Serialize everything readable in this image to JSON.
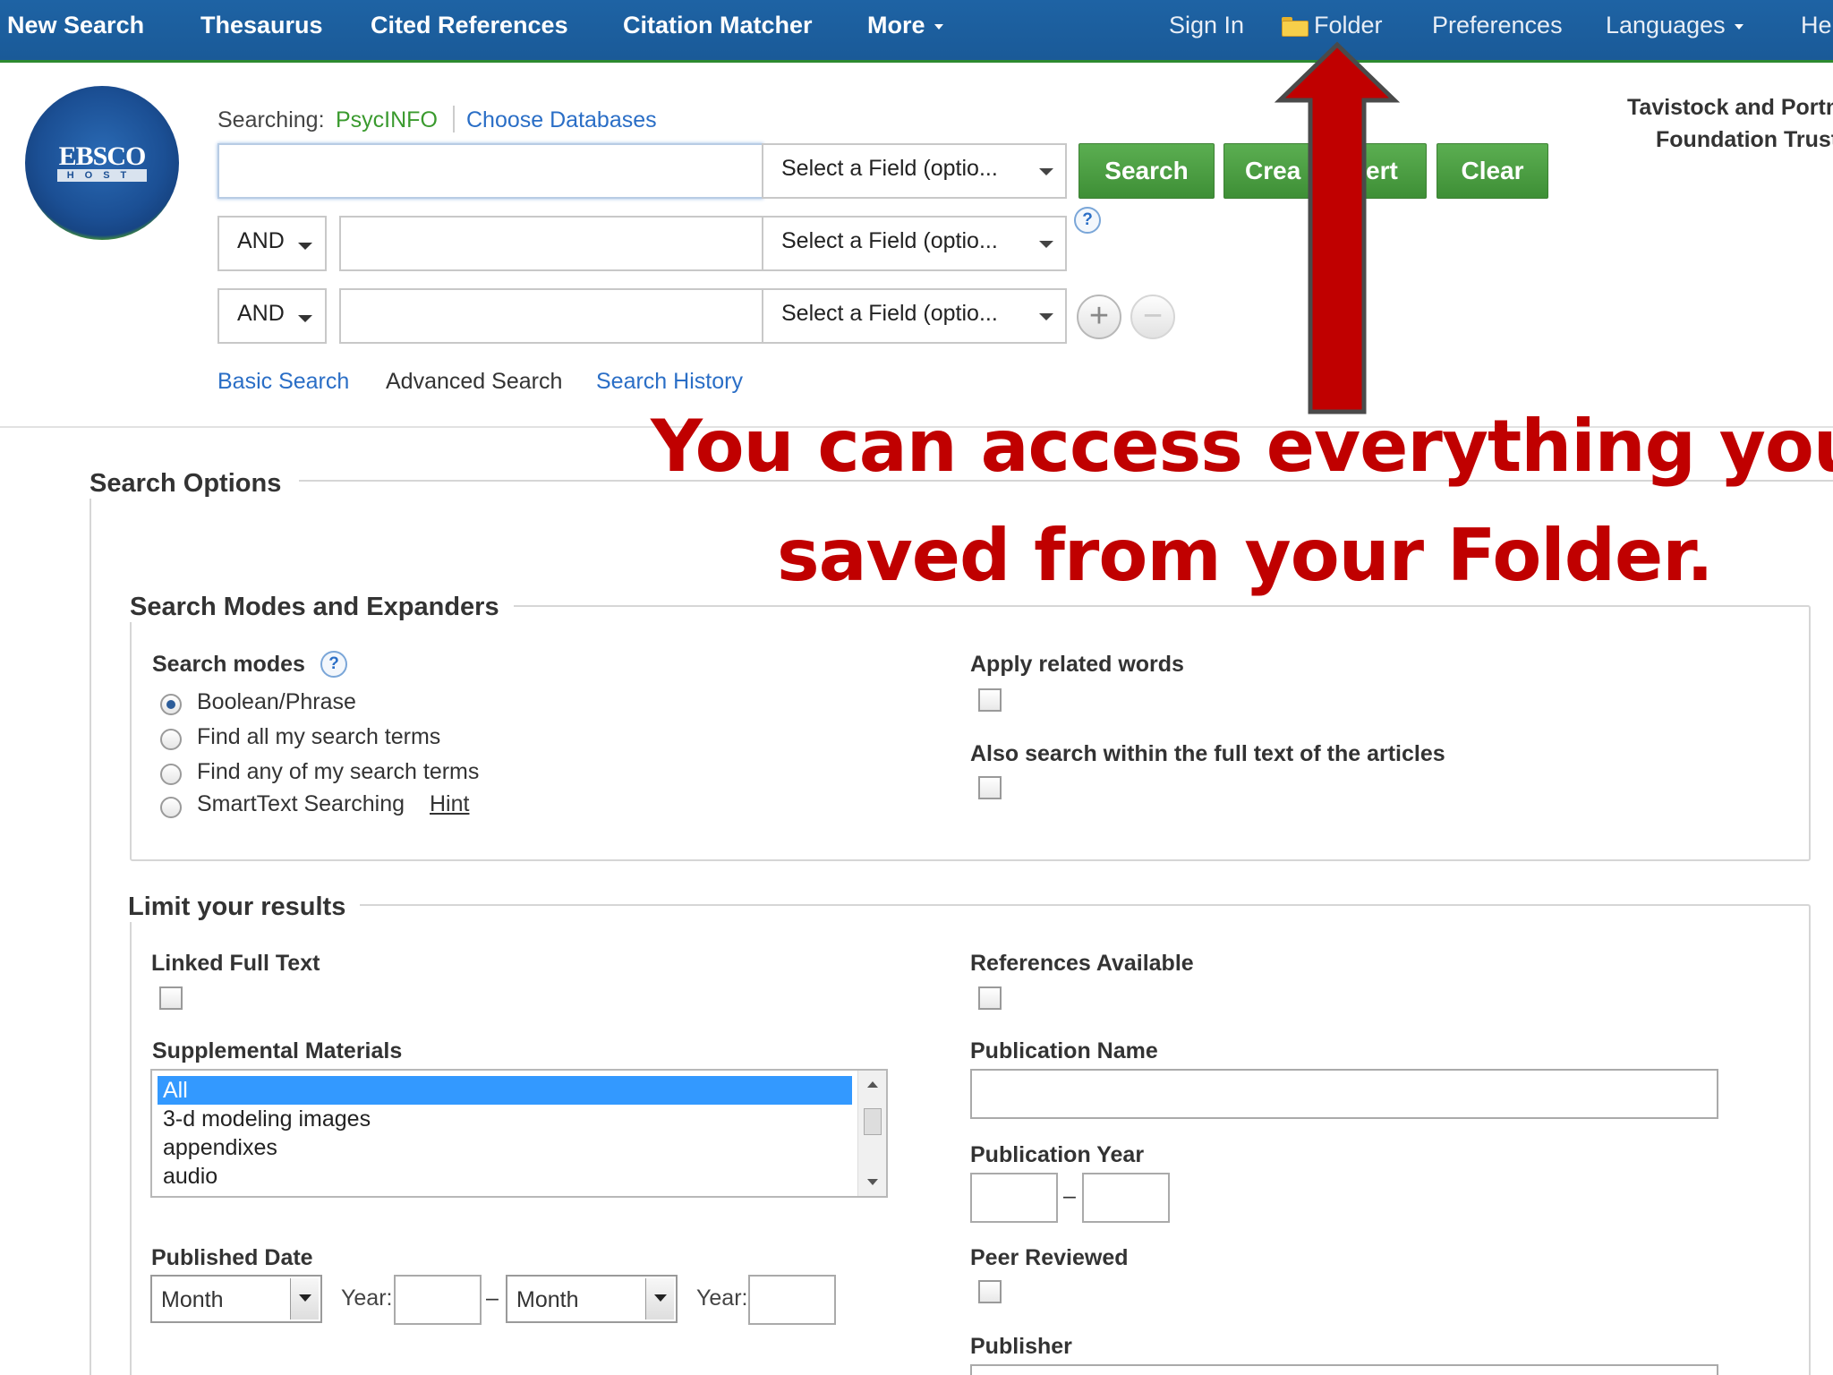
{
  "nav": {
    "left": [
      "New Search",
      "Thesaurus",
      "Cited References",
      "Citation Matcher",
      "More"
    ],
    "right": {
      "sign_in": "Sign In",
      "folder": "Folder",
      "preferences": "Preferences",
      "languages": "Languages",
      "help": "He"
    }
  },
  "institution": {
    "line1": "Tavistock and Portm",
    "line2": "Foundation Trust"
  },
  "logo": {
    "text": "EBSCO",
    "subtext": "HOST"
  },
  "search": {
    "searching_label": "Searching:",
    "database": "PsycINFO",
    "choose_databases": "Choose Databases",
    "field_select": "Select a Field (optio...",
    "bool_op": "AND",
    "buttons": {
      "search": "Search",
      "create_alert_left": "Crea",
      "create_alert_right": "ert",
      "clear": "Clear"
    },
    "help": "?",
    "add_row": "+",
    "remove_row": "−",
    "links": {
      "basic": "Basic Search",
      "advanced": "Advanced Search",
      "history": "Search History"
    }
  },
  "options": {
    "title": "Search Options",
    "modes_expanders": {
      "title": "Search Modes and Expanders",
      "search_modes_label": "Search modes",
      "modes": [
        "Boolean/Phrase",
        "Find all my search terms",
        "Find any of my search terms",
        "SmartText Searching"
      ],
      "hint": "Hint",
      "apply_related": "Apply related words",
      "full_text_search": "Also search within the full text of the articles"
    },
    "limit": {
      "title": "Limit your results",
      "linked_full_text": "Linked Full Text",
      "references_available": "References Available",
      "supplemental_materials": "Supplemental Materials",
      "supplemental_options": [
        "All",
        "3-d modeling images",
        "appendixes",
        "audio"
      ],
      "publication_name": "Publication Name",
      "publication_year": "Publication Year",
      "year_sep": "–",
      "published_date": "Published Date",
      "month": "Month",
      "year": "Year:",
      "peer_reviewed": "Peer Reviewed",
      "publisher": "Publisher"
    }
  },
  "annotation": {
    "line1": "You can access everything you",
    "line2": "saved from your Folder.",
    "color": "#c00000"
  },
  "colors": {
    "nav_bg": "#1e63a4",
    "green_button": "#4a9e42",
    "link": "#2a6ec6",
    "selected_item": "#3399ff"
  }
}
